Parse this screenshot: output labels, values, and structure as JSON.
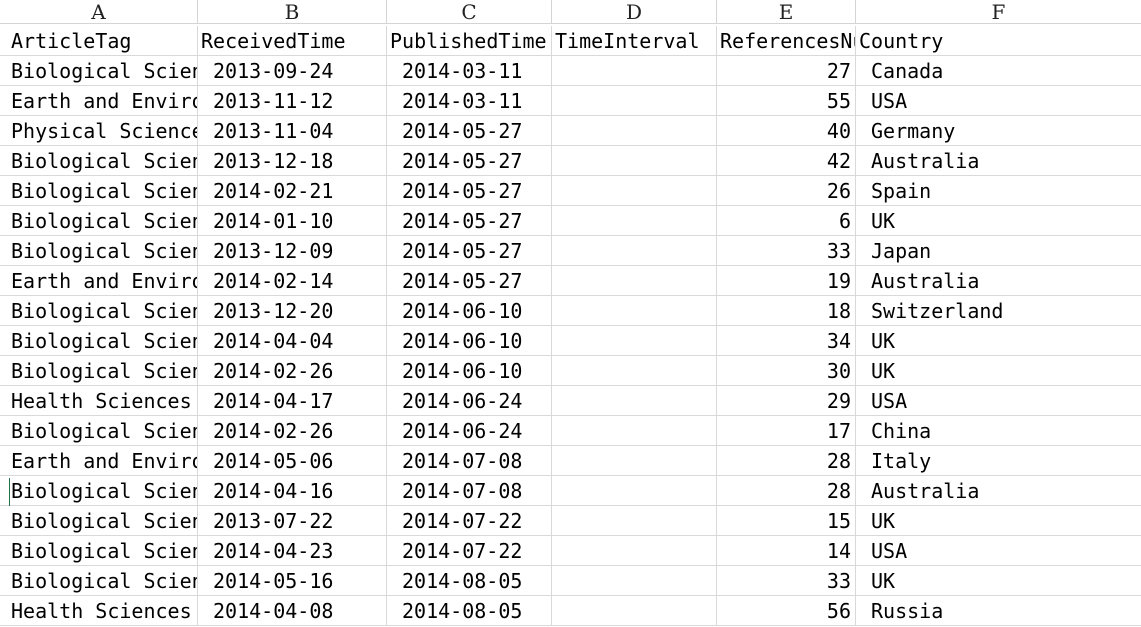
{
  "columns": [
    "A",
    "B",
    "C",
    "D",
    "E",
    "F"
  ],
  "header": [
    "ArticleTag",
    "ReceivedTime",
    "PublishedTime",
    "TimeInterval",
    "ReferencesNu",
    "Country"
  ],
  "rows": [
    [
      "Biological Sciences",
      "2013-09-24",
      "2014-03-11",
      "",
      "27",
      "Canada"
    ],
    [
      "Earth and Environmental Sciences",
      "2013-11-12",
      "2014-03-11",
      "",
      "55",
      "USA"
    ],
    [
      "Physical Sciences",
      "2013-11-04",
      "2014-05-27",
      "",
      "40",
      "Germany"
    ],
    [
      "Biological Sciences",
      "2013-12-18",
      "2014-05-27",
      "",
      "42",
      "Australia"
    ],
    [
      "Biological Sciences",
      "2014-02-21",
      "2014-05-27",
      "",
      "26",
      "Spain"
    ],
    [
      "Biological Sciences",
      "2014-01-10",
      "2014-05-27",
      "",
      "6",
      "UK"
    ],
    [
      "Biological Sciences",
      "2013-12-09",
      "2014-05-27",
      "",
      "33",
      "Japan"
    ],
    [
      "Earth and Environmental Sciences",
      "2014-02-14",
      "2014-05-27",
      "",
      "19",
      "Australia"
    ],
    [
      "Biological Sciences",
      "2013-12-20",
      "2014-06-10",
      "",
      "18",
      "Switzerland"
    ],
    [
      "Biological Sciences",
      "2014-04-04",
      "2014-06-10",
      "",
      "34",
      "UK"
    ],
    [
      "Biological Sciences",
      "2014-02-26",
      "2014-06-10",
      "",
      "30",
      "UK"
    ],
    [
      "Health Sciences",
      "2014-04-17",
      "2014-06-24",
      "",
      "29",
      "USA"
    ],
    [
      "Biological Sciences",
      "2014-02-26",
      "2014-06-24",
      "",
      "17",
      "China"
    ],
    [
      "Earth and Environmental Sciences",
      "2014-05-06",
      "2014-07-08",
      "",
      "28",
      "Italy"
    ],
    [
      "Biological Sciences",
      "2014-04-16",
      "2014-07-08",
      "",
      "28",
      "Australia"
    ],
    [
      "Biological Sciences",
      "2013-07-22",
      "2014-07-22",
      "",
      "15",
      "UK"
    ],
    [
      "Biological Sciences",
      "2014-04-23",
      "2014-07-22",
      "",
      "14",
      "USA"
    ],
    [
      "Biological Sciences",
      "2014-05-16",
      "2014-08-05",
      "",
      "33",
      "UK"
    ],
    [
      "Health Sciences",
      "2014-04-08",
      "2014-08-05",
      "",
      "56",
      "Russia"
    ]
  ],
  "colors": {
    "gridline": "#d9d9d9",
    "active_cell_marker": "#217346"
  }
}
